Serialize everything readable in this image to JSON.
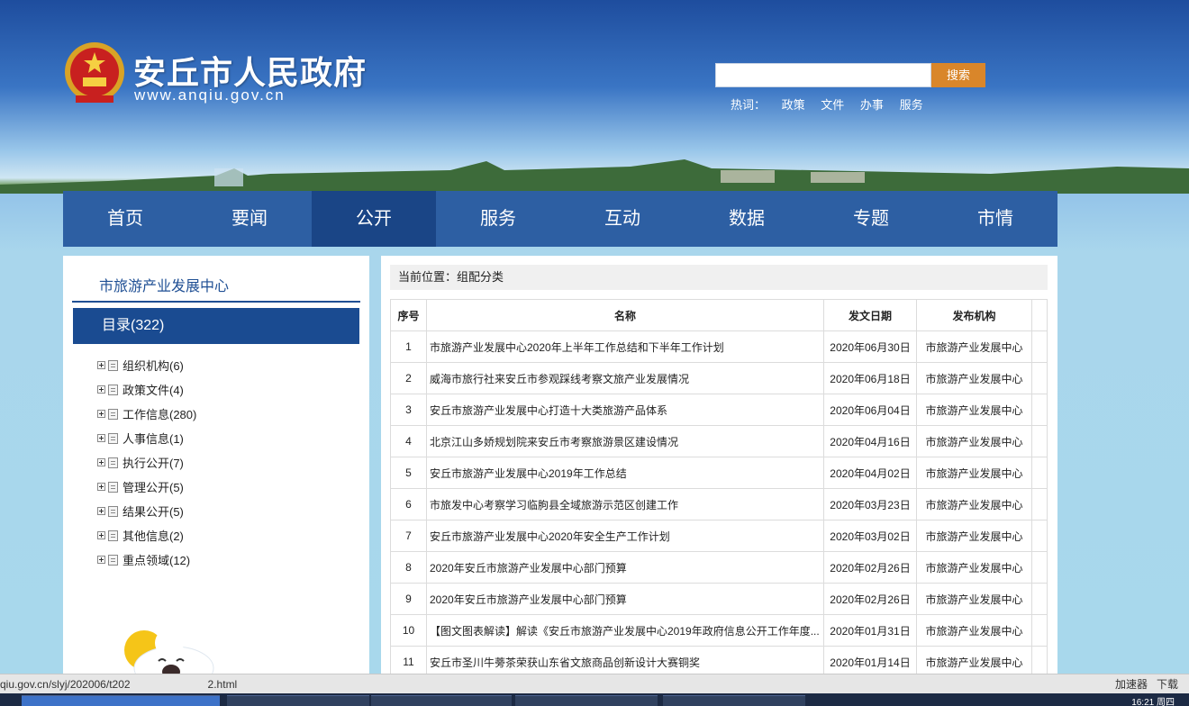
{
  "header": {
    "title": "安丘市人民政府",
    "url": "www.anqiu.gov.cn",
    "search_button": "搜索",
    "hot_label": "热词：",
    "hot_words": [
      "政策",
      "文件",
      "办事",
      "服务"
    ]
  },
  "nav": {
    "items": [
      "首页",
      "要闻",
      "公开",
      "服务",
      "互动",
      "数据",
      "专题",
      "市情"
    ],
    "active": "公开"
  },
  "sidebar": {
    "org_title": "市旅游产业发展中心",
    "catalog_label": "目录(322)",
    "tree": [
      "组织机构(6)",
      "政策文件(4)",
      "工作信息(280)",
      "人事信息(1)",
      "执行公开(7)",
      "管理公开(5)",
      "结果公开(5)",
      "其他信息(2)",
      "重点领域(12)"
    ]
  },
  "main": {
    "breadcrumb": "当前位置：组配分类",
    "columns": [
      "序号",
      "名称",
      "发文日期",
      "发布机构"
    ],
    "rows": [
      {
        "num": "1",
        "name": "市旅游产业发展中心2020年上半年工作总结和下半年工作计划",
        "date": "2020年06月30日",
        "org": "市旅游产业发展中心"
      },
      {
        "num": "2",
        "name": "威海市旅行社来安丘市参观踩线考察文旅产业发展情况",
        "date": "2020年06月18日",
        "org": "市旅游产业发展中心"
      },
      {
        "num": "3",
        "name": "安丘市旅游产业发展中心打造十大类旅游产品体系",
        "date": "2020年06月04日",
        "org": "市旅游产业发展中心"
      },
      {
        "num": "4",
        "name": "北京江山多娇规划院来安丘市考察旅游景区建设情况",
        "date": "2020年04月16日",
        "org": "市旅游产业发展中心"
      },
      {
        "num": "5",
        "name": "安丘市旅游产业发展中心2019年工作总结",
        "date": "2020年04月02日",
        "org": "市旅游产业发展中心"
      },
      {
        "num": "6",
        "name": "市旅发中心考察学习临朐县全域旅游示范区创建工作",
        "date": "2020年03月23日",
        "org": "市旅游产业发展中心"
      },
      {
        "num": "7",
        "name": "安丘市旅游产业发展中心2020年安全生产工作计划",
        "date": "2020年03月02日",
        "org": "市旅游产业发展中心"
      },
      {
        "num": "8",
        "name": "2020年安丘市旅游产业发展中心部门预算",
        "date": "2020年02月26日",
        "org": "市旅游产业发展中心"
      },
      {
        "num": "9",
        "name": "2020年安丘市旅游产业发展中心部门预算",
        "date": "2020年02月26日",
        "org": "市旅游产业发展中心"
      },
      {
        "num": "10",
        "name": "【图文图表解读】解读《安丘市旅游产业发展中心2019年政府信息公开工作年度...",
        "date": "2020年01月31日",
        "org": "市旅游产业发展中心"
      },
      {
        "num": "11",
        "name": "安丘市圣川牛蒡茶荣获山东省文旅商品创新设计大赛铜奖",
        "date": "2020年01月14日",
        "org": "市旅游产业发展中心"
      }
    ]
  },
  "statusbar": {
    "url": "qiu.gov.cn/slyj/202006/t202",
    "url_tail": "2.html",
    "tools": [
      "加速器",
      "下载"
    ]
  },
  "taskbar": {
    "clock": "16:21 周四"
  },
  "colors": {
    "nav_bg": "#2d5fa3",
    "nav_active": "#1a4586",
    "search_button": "#d9862a",
    "catalog_bg": "#1a4b91"
  }
}
